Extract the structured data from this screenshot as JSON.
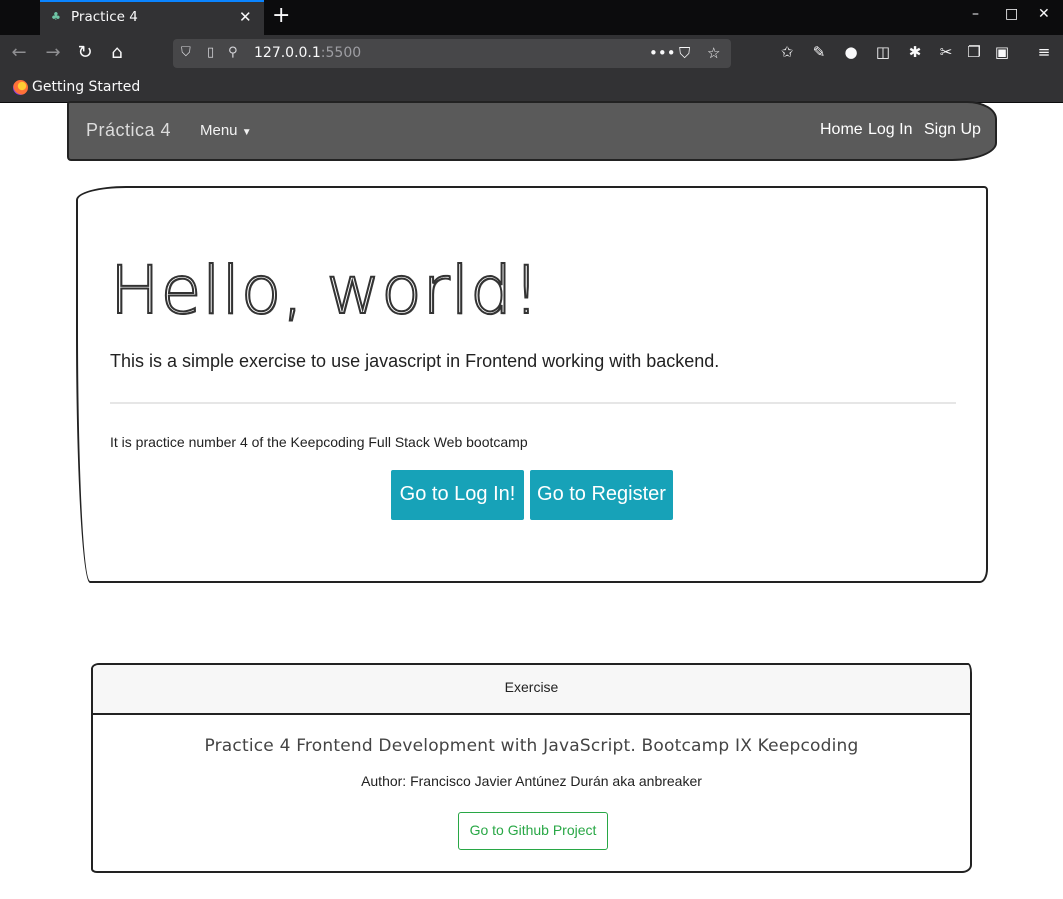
{
  "browser": {
    "tab": {
      "title": "Practice 4",
      "favicon": "leaf-icon"
    },
    "url": {
      "host": "127.0.0.1",
      "port": ":5500"
    },
    "bookmarks": [
      {
        "label": "Getting Started",
        "icon": "firefox-icon"
      }
    ],
    "accent": "#0a84ff"
  },
  "navbar": {
    "brand": "Práctica 4",
    "menu_label": "Menu",
    "links": {
      "home": "Home",
      "login": "Log In",
      "signup": "Sign Up"
    },
    "background": "#5a5a5a"
  },
  "jumbotron": {
    "title": "Hello, world!",
    "lead": "This is a simple exercise to use javascript in Frontend working with backend.",
    "text": "It is practice number 4 of the Keepcoding Full Stack Web bootcamp",
    "buttons": {
      "login": "Go to Log In!",
      "register": "Go to Register"
    },
    "button_color": "#17a2b8"
  },
  "card": {
    "header": "Exercise",
    "title": "Practice 4 Frontend Development with JavaScript. Bootcamp IX Keepcoding",
    "author": "Author: Francisco Javier Antúnez Durán aka anbreaker",
    "button": "Go to Github Project",
    "button_color": "#28a745"
  }
}
